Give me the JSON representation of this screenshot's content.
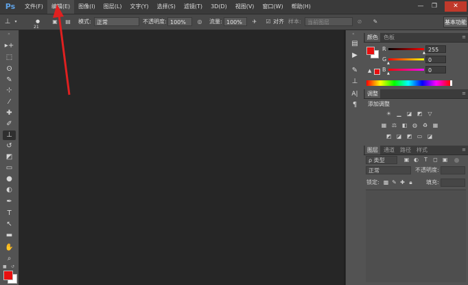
{
  "menubar": {
    "logo": "Ps",
    "items": [
      {
        "label": "文件(F)"
      },
      {
        "label": "编辑(E)"
      },
      {
        "label": "图像(I)"
      },
      {
        "label": "图层(L)"
      },
      {
        "label": "文字(Y)"
      },
      {
        "label": "选择(S)"
      },
      {
        "label": "滤镜(T)"
      },
      {
        "label": "3D(D)"
      },
      {
        "label": "视图(V)"
      },
      {
        "label": "窗口(W)"
      },
      {
        "label": "帮助(H)"
      }
    ],
    "window_controls": {
      "minimize": "—",
      "restore": "❐",
      "close": "✕"
    }
  },
  "options": {
    "brush_size": "21",
    "mode_label": "模式:",
    "mode_value": "正常",
    "opacity_label": "不透明度:",
    "opacity_value": "100%",
    "flow_label": "流量:",
    "flow_value": "100%",
    "aligned_label": "对齐",
    "sample_label": "样本:",
    "sample_value": "当前图层",
    "workspace": "基本功能"
  },
  "toolbox": {
    "tools": [
      {
        "name": "move-tool",
        "glyph": "▸+"
      },
      {
        "name": "marquee-tool",
        "glyph": "⬚"
      },
      {
        "name": "lasso-tool",
        "glyph": "ʘ"
      },
      {
        "name": "quick-select-tool",
        "glyph": "✎"
      },
      {
        "name": "crop-tool",
        "glyph": "⊹"
      },
      {
        "name": "eyedropper-tool",
        "glyph": "⁄"
      },
      {
        "name": "healing-tool",
        "glyph": "✚"
      },
      {
        "name": "brush-tool",
        "glyph": "✐"
      },
      {
        "name": "clone-stamp-tool",
        "glyph": "⊥"
      },
      {
        "name": "history-brush-tool",
        "glyph": "↺"
      },
      {
        "name": "eraser-tool",
        "glyph": "◩"
      },
      {
        "name": "gradient-tool",
        "glyph": "▭"
      },
      {
        "name": "blur-tool",
        "glyph": "●"
      },
      {
        "name": "dodge-tool",
        "glyph": "◐"
      },
      {
        "name": "pen-tool",
        "glyph": "✒"
      },
      {
        "name": "type-tool",
        "glyph": "T"
      },
      {
        "name": "path-select-tool",
        "glyph": "↖"
      },
      {
        "name": "shape-tool",
        "glyph": "▬"
      },
      {
        "name": "hand-tool",
        "glyph": "✋"
      },
      {
        "name": "zoom-tool",
        "glyph": "⌕"
      }
    ],
    "foreground_color": "#e81010",
    "background_color": "#ffffff"
  },
  "color_panel": {
    "tabs": [
      "颜色",
      "色板"
    ],
    "channels": [
      {
        "label": "R",
        "value": "255"
      },
      {
        "label": "G",
        "value": "0"
      },
      {
        "label": "B",
        "value": "0"
      }
    ]
  },
  "adjustments_panel": {
    "tab": "调整",
    "title": "添加调整"
  },
  "layers_panel": {
    "tabs": [
      "图层",
      "通道",
      "路径",
      "样式"
    ],
    "filter_label": "ρ 类型",
    "blend_mode": "正常",
    "opacity_label": "不透明度:",
    "lock_label": "锁定:",
    "fill_label": "填充:"
  }
}
